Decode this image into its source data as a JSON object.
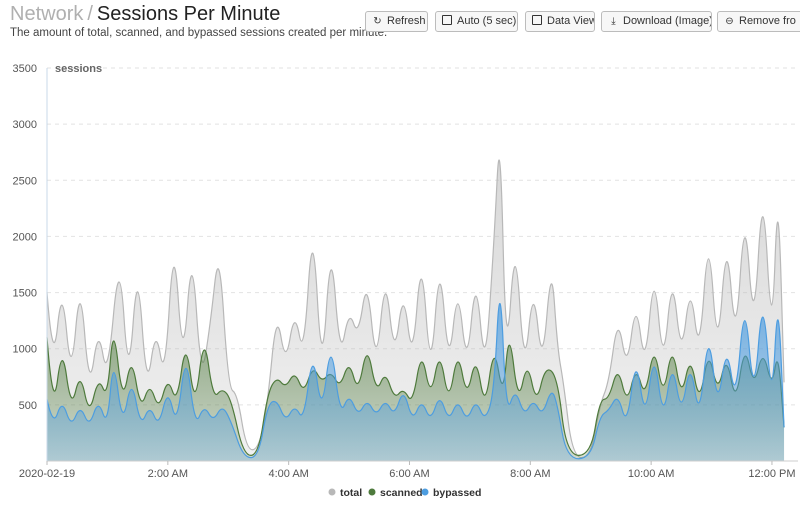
{
  "header": {
    "breadcrumb": "Network",
    "separator": "/",
    "title": "Sessions Per Minute",
    "subtitle": "The amount of total, scanned, and bypassed sessions created per minute."
  },
  "toolbar": {
    "refresh_label": "Refresh",
    "auto_label": "Auto (5 sec)",
    "dataview_label": "Data View",
    "download_label": "Download (Image)",
    "remove_label": "Remove fro"
  },
  "chart_data": {
    "type": "area",
    "ylabel": "sessions",
    "ylim": [
      0,
      3500
    ],
    "yticks": [
      "500",
      "1000",
      "1500",
      "2000",
      "2500",
      "3000",
      "3500"
    ],
    "xticks": [
      "2020-02-19",
      "2:00 AM",
      "4:00 AM",
      "6:00 AM",
      "8:00 AM",
      "10:00 AM",
      "12:00 PM"
    ],
    "xrange_hours": [
      0,
      12.1
    ],
    "grid": true,
    "legend_position": "bottom",
    "series": [
      {
        "name": "total",
        "color": "#b8b8b8",
        "points": [
          [
            0.0,
            1500
          ],
          [
            0.1,
            800
          ],
          [
            0.25,
            1600
          ],
          [
            0.4,
            700
          ],
          [
            0.55,
            1650
          ],
          [
            0.7,
            600
          ],
          [
            0.85,
            1200
          ],
          [
            1.0,
            700
          ],
          [
            1.2,
            1900
          ],
          [
            1.35,
            650
          ],
          [
            1.5,
            1800
          ],
          [
            1.65,
            600
          ],
          [
            1.8,
            1200
          ],
          [
            1.95,
            700
          ],
          [
            2.1,
            2050
          ],
          [
            2.25,
            800
          ],
          [
            2.4,
            1950
          ],
          [
            2.55,
            700
          ],
          [
            2.7,
            1200
          ],
          [
            2.85,
            1950
          ],
          [
            3.0,
            650
          ],
          [
            3.15,
            600
          ],
          [
            3.3,
            100
          ],
          [
            3.5,
            100
          ],
          [
            3.65,
            500
          ],
          [
            3.8,
            1350
          ],
          [
            3.95,
            850
          ],
          [
            4.1,
            1350
          ],
          [
            4.25,
            900
          ],
          [
            4.4,
            2200
          ],
          [
            4.55,
            700
          ],
          [
            4.7,
            2000
          ],
          [
            4.85,
            900
          ],
          [
            5.0,
            1350
          ],
          [
            5.15,
            1100
          ],
          [
            5.3,
            1650
          ],
          [
            5.45,
            800
          ],
          [
            5.6,
            1700
          ],
          [
            5.75,
            900
          ],
          [
            5.9,
            1550
          ],
          [
            6.05,
            850
          ],
          [
            6.2,
            1900
          ],
          [
            6.35,
            700
          ],
          [
            6.5,
            1850
          ],
          [
            6.65,
            800
          ],
          [
            6.8,
            1600
          ],
          [
            6.95,
            800
          ],
          [
            7.1,
            1700
          ],
          [
            7.25,
            750
          ],
          [
            7.4,
            1950
          ],
          [
            7.5,
            3050
          ],
          [
            7.6,
            800
          ],
          [
            7.75,
            2050
          ],
          [
            7.9,
            750
          ],
          [
            8.05,
            1600
          ],
          [
            8.2,
            800
          ],
          [
            8.35,
            1800
          ],
          [
            8.45,
            1000
          ],
          [
            8.55,
            700
          ],
          [
            8.7,
            30
          ],
          [
            9.0,
            30
          ],
          [
            9.15,
            500
          ],
          [
            9.3,
            700
          ],
          [
            9.45,
            1300
          ],
          [
            9.6,
            800
          ],
          [
            9.75,
            1450
          ],
          [
            9.9,
            800
          ],
          [
            10.05,
            1750
          ],
          [
            10.2,
            800
          ],
          [
            10.35,
            1700
          ],
          [
            10.5,
            900
          ],
          [
            10.65,
            1600
          ],
          [
            10.8,
            900
          ],
          [
            10.95,
            2100
          ],
          [
            11.1,
            900
          ],
          [
            11.25,
            2050
          ],
          [
            11.4,
            1000
          ],
          [
            11.55,
            2300
          ],
          [
            11.7,
            1100
          ],
          [
            11.85,
            2550
          ],
          [
            12.0,
            1000
          ],
          [
            12.1,
            2550
          ],
          [
            12.2,
            700
          ]
        ]
      },
      {
        "name": "scanned",
        "color": "#4e7a3c",
        "points": [
          [
            0.0,
            1100
          ],
          [
            0.1,
            400
          ],
          [
            0.25,
            1050
          ],
          [
            0.4,
            450
          ],
          [
            0.55,
            800
          ],
          [
            0.7,
            400
          ],
          [
            0.85,
            750
          ],
          [
            1.0,
            550
          ],
          [
            1.1,
            1250
          ],
          [
            1.25,
            500
          ],
          [
            1.4,
            950
          ],
          [
            1.55,
            450
          ],
          [
            1.7,
            700
          ],
          [
            1.85,
            450
          ],
          [
            2.0,
            750
          ],
          [
            2.15,
            500
          ],
          [
            2.3,
            1100
          ],
          [
            2.45,
            450
          ],
          [
            2.6,
            1150
          ],
          [
            2.75,
            550
          ],
          [
            2.9,
            650
          ],
          [
            3.05,
            550
          ],
          [
            3.25,
            50
          ],
          [
            3.5,
            50
          ],
          [
            3.65,
            600
          ],
          [
            3.8,
            750
          ],
          [
            3.95,
            650
          ],
          [
            4.1,
            800
          ],
          [
            4.25,
            600
          ],
          [
            4.4,
            850
          ],
          [
            4.55,
            700
          ],
          [
            4.7,
            800
          ],
          [
            4.85,
            650
          ],
          [
            5.0,
            900
          ],
          [
            5.15,
            600
          ],
          [
            5.3,
            1050
          ],
          [
            5.45,
            600
          ],
          [
            5.6,
            800
          ],
          [
            5.75,
            550
          ],
          [
            5.9,
            650
          ],
          [
            6.05,
            500
          ],
          [
            6.2,
            1000
          ],
          [
            6.35,
            550
          ],
          [
            6.5,
            1000
          ],
          [
            6.65,
            500
          ],
          [
            6.8,
            1000
          ],
          [
            6.95,
            550
          ],
          [
            7.1,
            950
          ],
          [
            7.25,
            450
          ],
          [
            7.4,
            1050
          ],
          [
            7.55,
            550
          ],
          [
            7.65,
            1200
          ],
          [
            7.8,
            500
          ],
          [
            7.95,
            900
          ],
          [
            8.1,
            500
          ],
          [
            8.25,
            850
          ],
          [
            8.45,
            750
          ],
          [
            8.6,
            50
          ],
          [
            9.0,
            50
          ],
          [
            9.15,
            550
          ],
          [
            9.3,
            550
          ],
          [
            9.45,
            850
          ],
          [
            9.6,
            500
          ],
          [
            9.75,
            850
          ],
          [
            9.9,
            550
          ],
          [
            10.05,
            1050
          ],
          [
            10.2,
            550
          ],
          [
            10.35,
            1050
          ],
          [
            10.5,
            550
          ],
          [
            10.65,
            950
          ],
          [
            10.8,
            500
          ],
          [
            10.95,
            1000
          ],
          [
            11.1,
            600
          ],
          [
            11.25,
            950
          ],
          [
            11.4,
            500
          ],
          [
            11.55,
            1050
          ],
          [
            11.7,
            650
          ],
          [
            11.85,
            1000
          ],
          [
            12.0,
            650
          ],
          [
            12.1,
            1000
          ],
          [
            12.2,
            300
          ]
        ]
      },
      {
        "name": "bypassed",
        "color": "#4d9de0",
        "points": [
          [
            0.0,
            550
          ],
          [
            0.1,
            300
          ],
          [
            0.25,
            550
          ],
          [
            0.4,
            300
          ],
          [
            0.55,
            500
          ],
          [
            0.7,
            300
          ],
          [
            0.85,
            550
          ],
          [
            1.0,
            300
          ],
          [
            1.1,
            950
          ],
          [
            1.25,
            300
          ],
          [
            1.4,
            750
          ],
          [
            1.55,
            300
          ],
          [
            1.7,
            500
          ],
          [
            1.85,
            300
          ],
          [
            2.0,
            650
          ],
          [
            2.15,
            300
          ],
          [
            2.3,
            1000
          ],
          [
            2.45,
            300
          ],
          [
            2.6,
            500
          ],
          [
            2.75,
            350
          ],
          [
            2.9,
            500
          ],
          [
            3.05,
            350
          ],
          [
            3.25,
            30
          ],
          [
            3.5,
            30
          ],
          [
            3.65,
            500
          ],
          [
            3.8,
            550
          ],
          [
            3.95,
            350
          ],
          [
            4.1,
            500
          ],
          [
            4.25,
            350
          ],
          [
            4.4,
            1000
          ],
          [
            4.55,
            400
          ],
          [
            4.7,
            1100
          ],
          [
            4.85,
            400
          ],
          [
            5.0,
            600
          ],
          [
            5.15,
            400
          ],
          [
            5.3,
            550
          ],
          [
            5.45,
            400
          ],
          [
            5.6,
            550
          ],
          [
            5.75,
            400
          ],
          [
            5.9,
            650
          ],
          [
            6.05,
            350
          ],
          [
            6.2,
            550
          ],
          [
            6.35,
            350
          ],
          [
            6.5,
            600
          ],
          [
            6.65,
            350
          ],
          [
            6.8,
            550
          ],
          [
            6.95,
            350
          ],
          [
            7.1,
            550
          ],
          [
            7.25,
            350
          ],
          [
            7.4,
            600
          ],
          [
            7.5,
            1700
          ],
          [
            7.6,
            400
          ],
          [
            7.75,
            650
          ],
          [
            7.9,
            400
          ],
          [
            8.05,
            550
          ],
          [
            8.2,
            400
          ],
          [
            8.35,
            650
          ],
          [
            8.45,
            500
          ],
          [
            8.6,
            20
          ],
          [
            9.0,
            20
          ],
          [
            9.15,
            400
          ],
          [
            9.3,
            450
          ],
          [
            9.45,
            600
          ],
          [
            9.6,
            300
          ],
          [
            9.75,
            950
          ],
          [
            9.9,
            350
          ],
          [
            10.05,
            1000
          ],
          [
            10.2,
            350
          ],
          [
            10.35,
            900
          ],
          [
            10.5,
            400
          ],
          [
            10.65,
            900
          ],
          [
            10.8,
            350
          ],
          [
            10.95,
            1200
          ],
          [
            11.1,
            450
          ],
          [
            11.25,
            1050
          ],
          [
            11.4,
            500
          ],
          [
            11.55,
            1500
          ],
          [
            11.7,
            500
          ],
          [
            11.85,
            1550
          ],
          [
            12.0,
            450
          ],
          [
            12.1,
            1550
          ],
          [
            12.2,
            300
          ]
        ]
      }
    ]
  }
}
